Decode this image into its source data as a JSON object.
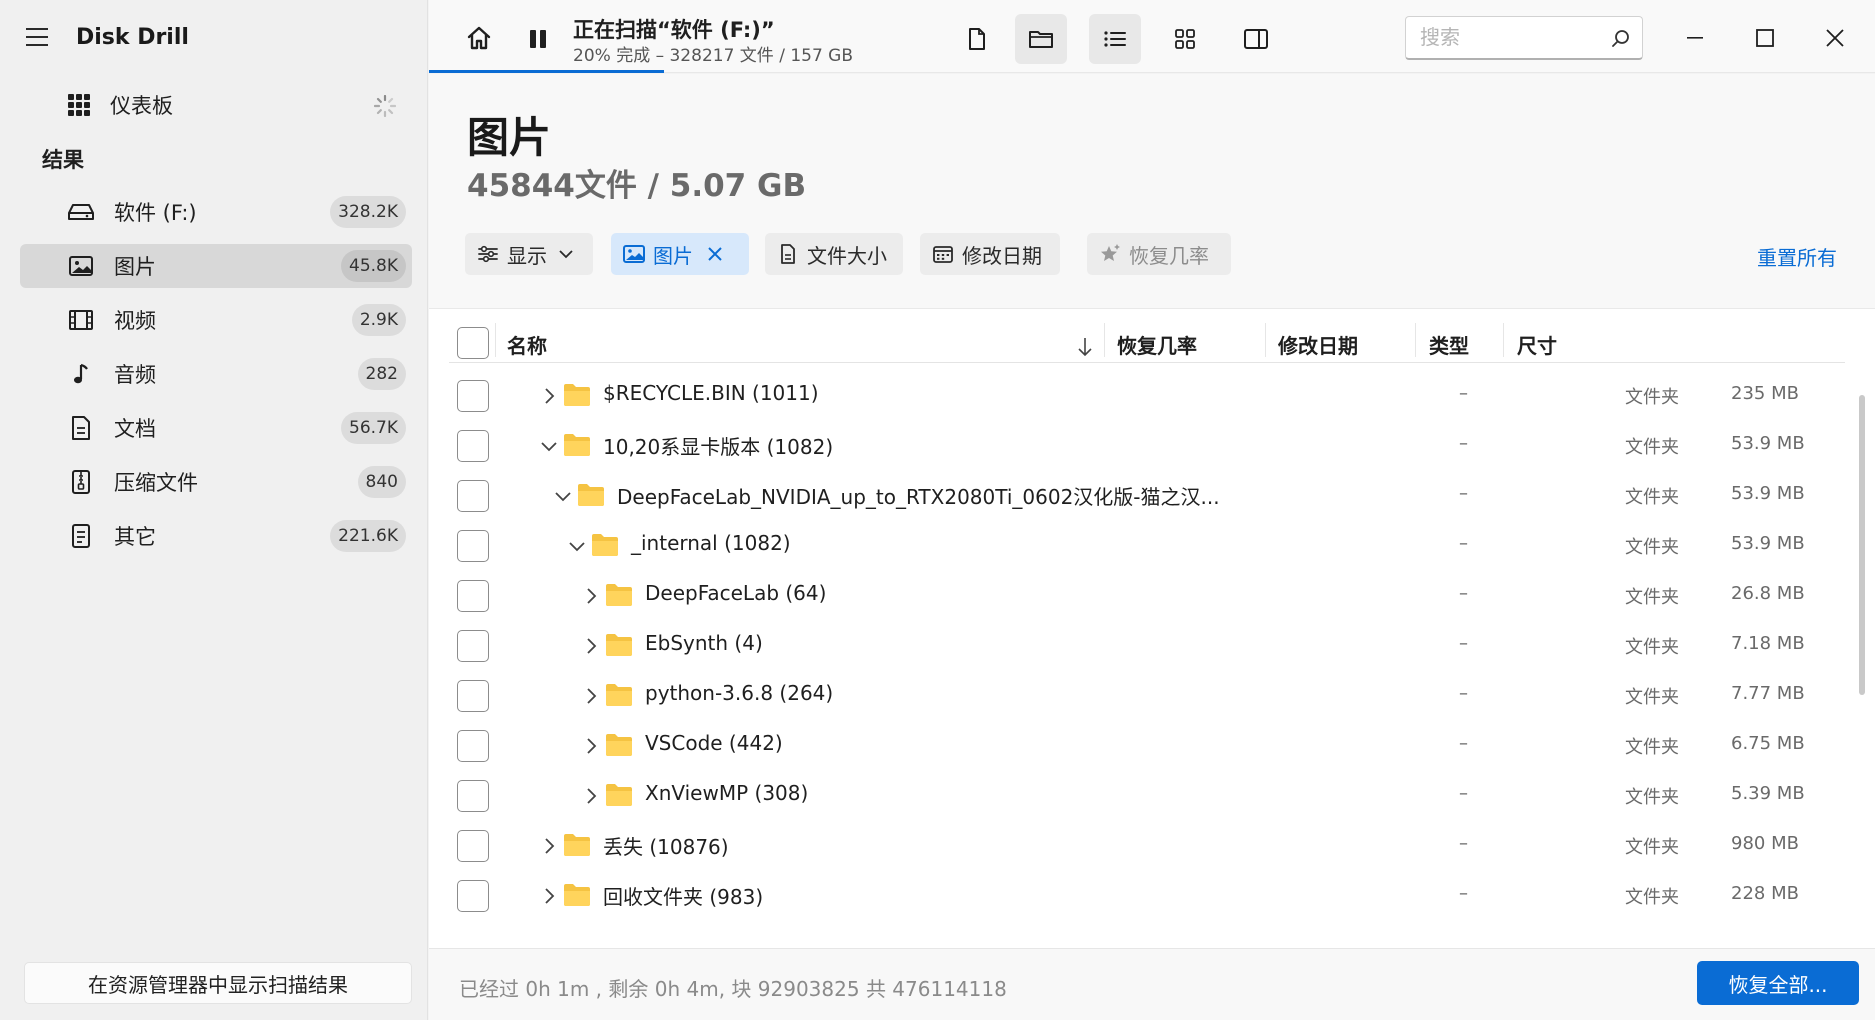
{
  "app": {
    "title": "Disk Drill"
  },
  "sidebar": {
    "dashboard_label": "仪表板",
    "section_title": "结果",
    "items": [
      {
        "label": "软件 (F:)",
        "count": "328.2K",
        "icon": "drive-icon"
      },
      {
        "label": "图片",
        "count": "45.8K",
        "icon": "image-icon"
      },
      {
        "label": "视频",
        "count": "2.9K",
        "icon": "film-icon"
      },
      {
        "label": "音频",
        "count": "282",
        "icon": "music-note-icon"
      },
      {
        "label": "文档",
        "count": "56.7K",
        "icon": "document-icon"
      },
      {
        "label": "压缩文件",
        "count": "840",
        "icon": "archive-icon"
      },
      {
        "label": "其它",
        "count": "221.6K",
        "icon": "other-file-icon"
      }
    ],
    "active_index": 1,
    "bottom_button": "在资源管理器中显示扫描结果"
  },
  "scan": {
    "title": "正在扫描“软件 (F:)”",
    "subtitle": "20% 完成 – 328217 文件 / 157 GB",
    "progress": 0.2
  },
  "search": {
    "placeholder": "搜索",
    "value": ""
  },
  "main": {
    "title": "图片",
    "subtitle": "45844文件 / 5.07 GB",
    "filters": {
      "display": "显示",
      "pictures": "图片",
      "file_size": "文件大小",
      "modified_date": "修改日期",
      "recovery_chance": "恢复几率"
    },
    "reset_all": "重置所有"
  },
  "table": {
    "headers": {
      "name": "名称",
      "recovery": "恢复几率",
      "date": "修改日期",
      "type": "类型",
      "size": "尺寸"
    },
    "rows": [
      {
        "name": "$RECYCLE.BIN (1011)",
        "date": "–",
        "type": "文件夹",
        "size": "235 MB",
        "expanded": false,
        "level": 0
      },
      {
        "name": "10,20系显卡版本 (1082)",
        "date": "–",
        "type": "文件夹",
        "size": "53.9 MB",
        "expanded": true,
        "level": 0
      },
      {
        "name": "DeepFaceLab_NVIDIA_up_to_RTX2080Ti_0602汉化版-猫之汉...",
        "date": "–",
        "type": "文件夹",
        "size": "53.9 MB",
        "expanded": true,
        "level": 1
      },
      {
        "name": "_internal (1082)",
        "date": "–",
        "type": "文件夹",
        "size": "53.9 MB",
        "expanded": true,
        "level": 2
      },
      {
        "name": "DeepFaceLab (64)",
        "date": "–",
        "type": "文件夹",
        "size": "26.8 MB",
        "expanded": false,
        "level": 3
      },
      {
        "name": "EbSynth (4)",
        "date": "–",
        "type": "文件夹",
        "size": "7.18 MB",
        "expanded": false,
        "level": 3
      },
      {
        "name": "python-3.6.8 (264)",
        "date": "–",
        "type": "文件夹",
        "size": "7.77 MB",
        "expanded": false,
        "level": 3
      },
      {
        "name": "VSCode (442)",
        "date": "–",
        "type": "文件夹",
        "size": "6.75 MB",
        "expanded": false,
        "level": 3
      },
      {
        "name": "XnViewMP (308)",
        "date": "–",
        "type": "文件夹",
        "size": "5.39 MB",
        "expanded": false,
        "level": 3
      },
      {
        "name": "丢失 (10876)",
        "date": "–",
        "type": "文件夹",
        "size": "980 MB",
        "expanded": false,
        "level": 0
      },
      {
        "name": "回收文件夹 (983)",
        "date": "–",
        "type": "文件夹",
        "size": "228 MB",
        "expanded": false,
        "level": 0
      }
    ]
  },
  "status": {
    "text": "已经过 0h 1m , 剩余 0h 4m, 块 92903825 共 476114118",
    "recover_button": "恢复全部..."
  },
  "colors": {
    "accent": "#0a6cd4",
    "folder": "#f5c342",
    "active_chip_bg": "#d7e8fb"
  }
}
